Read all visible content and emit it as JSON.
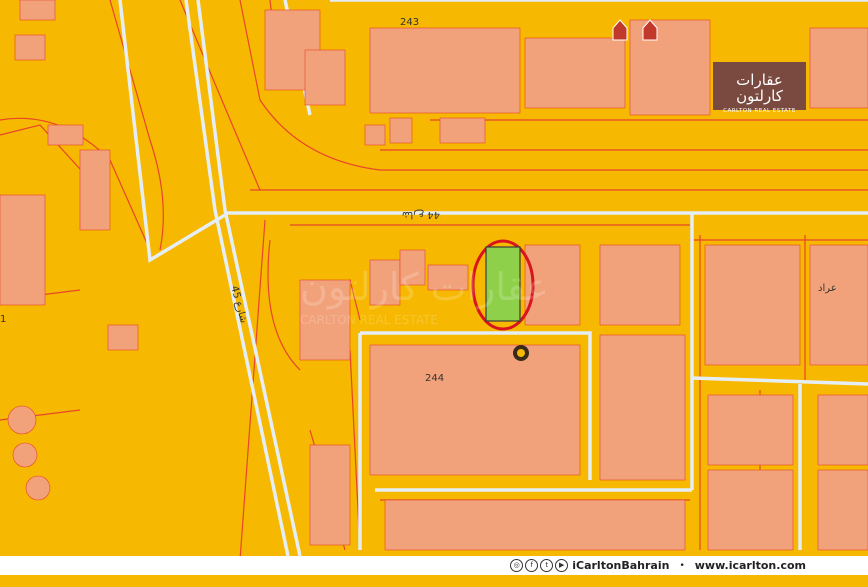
{
  "map": {
    "street_labels": {
      "block_243": "243",
      "block_244": "244",
      "road_44": "شارع 44",
      "road_45": "شارع 45",
      "road_1": "1",
      "arad": "عراد"
    },
    "watermark_ar": "عقارات كارلتون",
    "watermark_en": "CARLTON REAL ESTATE",
    "colors": {
      "background": "#f6b800",
      "parcel_outline": "#e8452a",
      "building_fill": "#f2a27a",
      "road_fill": "#e6eef5",
      "highlight_fill": "#8fd04a",
      "highlight_ring": "#d8141e"
    },
    "markers": [
      "house-icon",
      "house-icon",
      "restaurant-icon"
    ]
  },
  "logo": {
    "arabic": "عقارات كارلتون",
    "english": "CARLTON REAL ESTATE"
  },
  "footer": {
    "social_icons": [
      "instagram-icon",
      "facebook-icon",
      "twitter-icon",
      "youtube-icon"
    ],
    "handle": "iCarltonBahrain",
    "separator": "•",
    "website": "www.icarlton.com"
  }
}
